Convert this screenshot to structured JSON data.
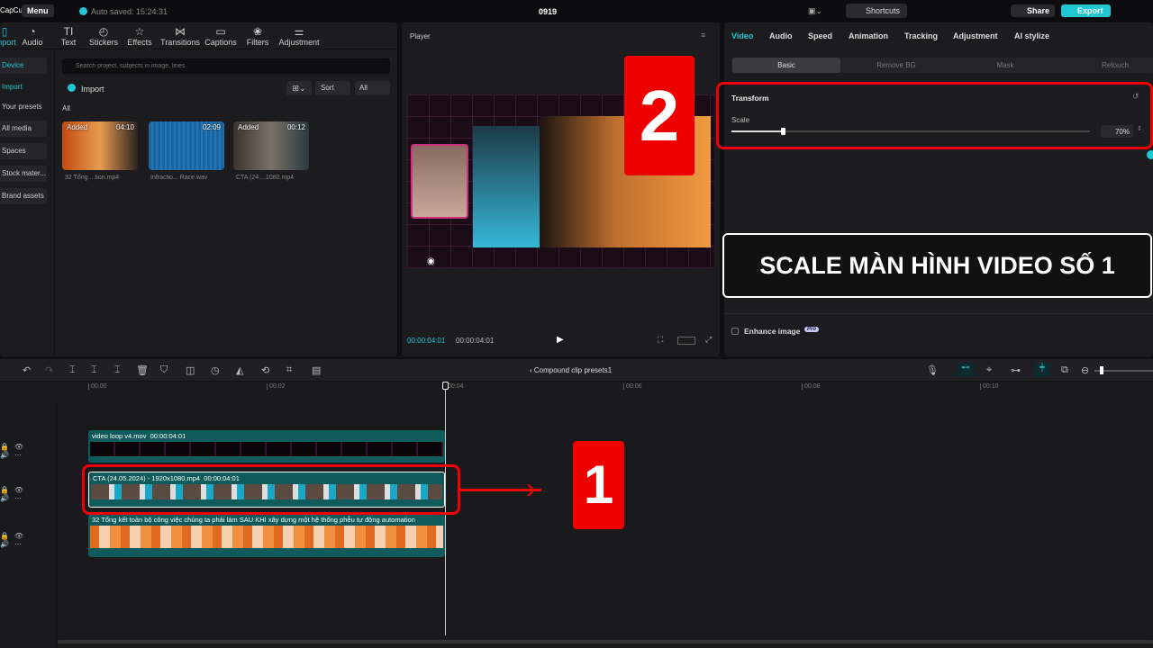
{
  "app": {
    "logo": "CapCut",
    "menu": "Menu",
    "autosave": "Auto saved: 15:24:31",
    "project_title": "0919",
    "shortcuts": "Shortcuts",
    "share": "Share",
    "export": "Export"
  },
  "toolbar": [
    "Import",
    "Audio",
    "Text",
    "Stickers",
    "Effects",
    "Transitions",
    "Captions",
    "Filters",
    "Adjustment"
  ],
  "sidebar": [
    "Device",
    "Import",
    "Your presets",
    "All media",
    "Spaces",
    "Stock mater...",
    "Brand assets"
  ],
  "media": {
    "search_placeholder": "Search project, subjects in image, lines",
    "import": "Import",
    "sort": "Sort",
    "filter": "All",
    "section": "All",
    "items": [
      {
        "badge": "Added",
        "duration": "04:10",
        "name": "32 Tổng ...tion.mp4"
      },
      {
        "badge": "",
        "duration": "02:09",
        "name": "Infractio... Race.wav"
      },
      {
        "badge": "Added",
        "duration": "00:12",
        "name": "CTA (24....1080.mp4"
      }
    ]
  },
  "player": {
    "title": "Player",
    "current": "00:00:04:01",
    "total": "00:00:04:01"
  },
  "inspector": {
    "tabs": [
      "Video",
      "Audio",
      "Speed",
      "Animation",
      "Tracking",
      "Adjustment",
      "AI stylize"
    ],
    "subtabs": [
      "Basic",
      "Remove BG",
      "Mask",
      "Retouch"
    ],
    "transform": "Transform",
    "scale_label": "Scale",
    "scale_value": "70%",
    "scale_fraction": 0.7,
    "enhance": "Enhance image",
    "pro": "Pro"
  },
  "timeline": {
    "breadcrumb": "Compound clip presets1",
    "ticks": [
      "00:00",
      "00:02",
      "00:04",
      "00:06",
      "00:08",
      "00:10"
    ],
    "clips": [
      {
        "name": "video loop v4.mov",
        "duration": "00:00:04:01"
      },
      {
        "name": "CTA (24.05.2024) - 1920x1080.mp4",
        "duration": "00:00:04:01"
      },
      {
        "name": "32 Tổng kết toàn bộ công việc chúng ta phải làm SAU KHI xây dựng một hệ thống phễu tự động automation",
        "duration": ""
      }
    ]
  },
  "annotations": {
    "label1": "1",
    "label2": "2",
    "caption": "SCALE MÀN HÌNH VIDEO SỐ 1"
  },
  "colors": {
    "accent": "#1fc8d4",
    "annotation": "#e00000",
    "clip": "#0f5a5a"
  }
}
